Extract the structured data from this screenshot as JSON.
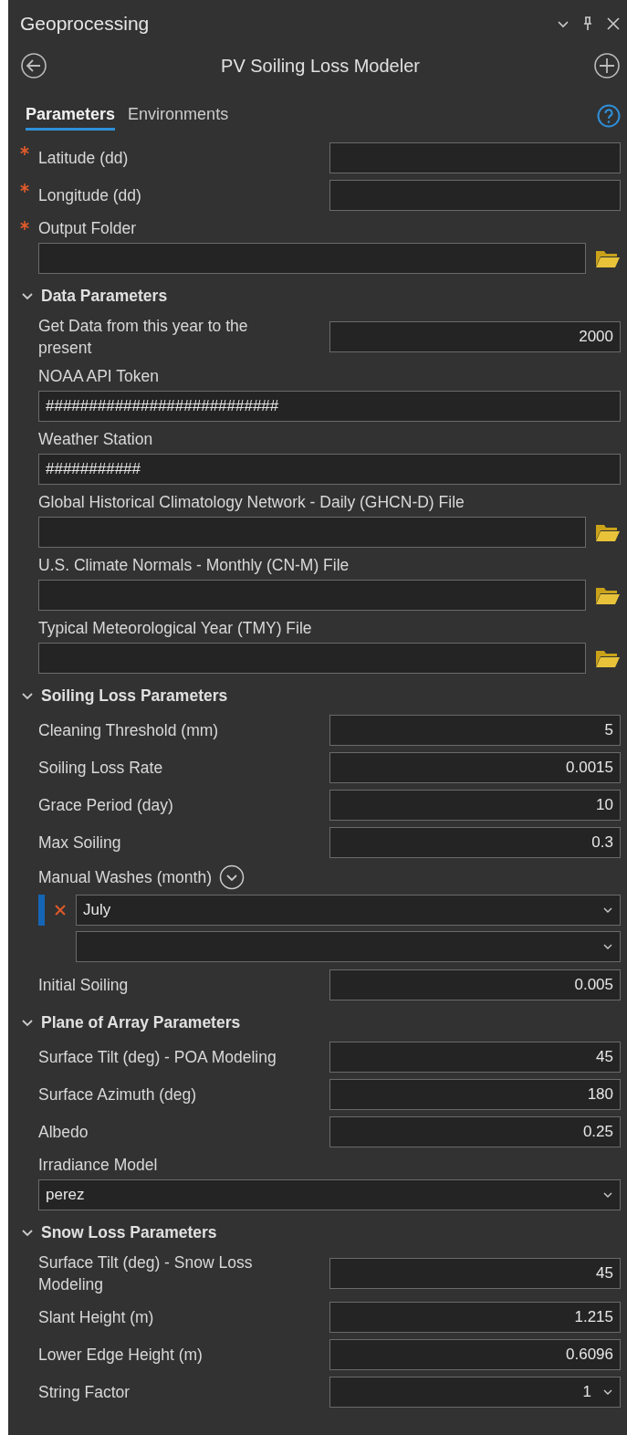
{
  "panel": {
    "title": "Geoprocessing"
  },
  "tool": {
    "title": "PV Soiling Loss Modeler"
  },
  "tabs": [
    {
      "label": "Parameters",
      "selected": true
    },
    {
      "label": "Environments",
      "selected": false
    }
  ],
  "params": [
    {
      "kind": "inline",
      "label": "Latitude (dd)",
      "required": true
    },
    {
      "kind": "inline",
      "label": "Longitude (dd)",
      "required": true
    },
    {
      "kind": "file",
      "label": "Output Folder",
      "required": true
    }
  ],
  "groups": [
    {
      "title": "Data Parameters",
      "expanded": true,
      "params": [
        {
          "kind": "inline",
          "label": "Get Data from this year to the present",
          "value": "2000"
        },
        {
          "kind": "stacked",
          "label": "NOAA API Token",
          "value": "###########################"
        },
        {
          "kind": "stacked",
          "label": "Weather Station",
          "value": "###########"
        },
        {
          "kind": "file",
          "label": "Global Historical Climatology Network - Daily (GHCN-D) File"
        },
        {
          "kind": "file",
          "label": "U.S. Climate Normals - Monthly (CN-M) File"
        },
        {
          "kind": "file",
          "label": "Typical Meteorological Year (TMY) File"
        }
      ]
    },
    {
      "title": "Soiling Loss Parameters",
      "expanded": true,
      "params": [
        {
          "kind": "inline",
          "label": "Cleaning Threshold (mm)",
          "value": "5"
        },
        {
          "kind": "inline",
          "label": "Soiling Loss Rate",
          "value": "0.0015"
        },
        {
          "kind": "inline",
          "label": "Grace Period (day)",
          "value": "10"
        },
        {
          "kind": "inline",
          "label": "Max Soiling",
          "value": "0.3"
        },
        {
          "kind": "multi",
          "label": "Manual Washes (month)",
          "items": [
            {
              "value": "July",
              "selected": true
            }
          ]
        },
        {
          "kind": "inline",
          "label": "Initial Soiling",
          "value": "0.005"
        }
      ]
    },
    {
      "title": "Plane of Array Parameters",
      "expanded": true,
      "params": [
        {
          "kind": "inline",
          "label": "Surface Tilt (deg) - POA Modeling",
          "value": "45"
        },
        {
          "kind": "inline",
          "label": "Surface Azimuth  (deg)",
          "value": "180"
        },
        {
          "kind": "inline",
          "label": "Albedo",
          "value": "0.25"
        },
        {
          "kind": "select_stacked",
          "label": "Irradiance Model",
          "value": "perez"
        }
      ]
    },
    {
      "title": "Snow Loss Parameters",
      "expanded": true,
      "params": [
        {
          "kind": "inline",
          "label": "Surface Tilt (deg) - Snow Loss Modeling",
          "value": "45"
        },
        {
          "kind": "inline",
          "label": "Slant Height (m)",
          "value": "1.215"
        },
        {
          "kind": "inline",
          "label": "Lower Edge Height (m)",
          "value": "0.6096"
        },
        {
          "kind": "select_inline",
          "label": "String Factor",
          "value": "1"
        }
      ]
    }
  ]
}
